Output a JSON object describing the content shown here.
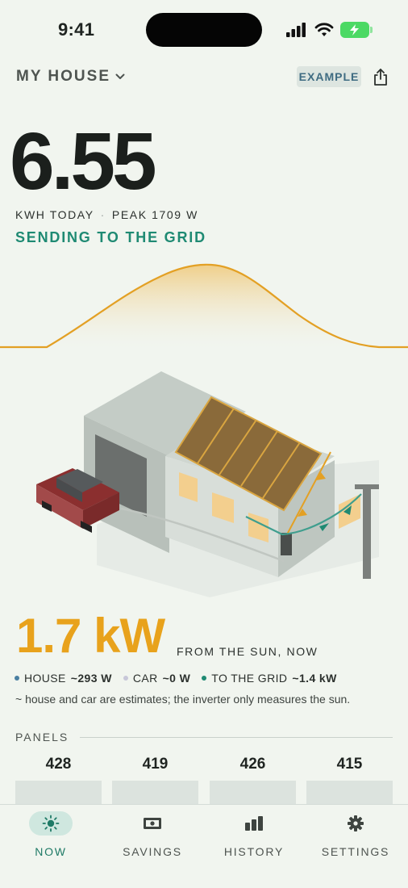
{
  "status_bar": {
    "time": "9:41"
  },
  "header": {
    "house_name": "MY HOUSE",
    "example_badge": "EXAMPLE"
  },
  "today": {
    "energy_value": "6.55",
    "unit_label": "KWH TODAY",
    "separator": "·",
    "peak_label": "PEAK 1709 W",
    "grid_status": "SENDING TO THE GRID"
  },
  "now": {
    "power_value": "1.7 kW",
    "power_suffix": "FROM THE SUN, NOW",
    "legend": [
      {
        "label": "HOUSE",
        "value": "~293 W",
        "color": "#4a7fa1"
      },
      {
        "label": "CAR",
        "value": "~0 W",
        "color": "#c7c7d9"
      },
      {
        "label": "TO THE GRID",
        "value": "~1.4 kW",
        "color": "#1f8a73"
      }
    ],
    "note": "~ house and car are estimates; the inverter only measures the sun."
  },
  "panels": {
    "label": "PANELS",
    "values": [
      "428",
      "419",
      "426",
      "415"
    ]
  },
  "nav": [
    {
      "label": "NOW",
      "icon": "sun-icon",
      "active": true
    },
    {
      "label": "SAVINGS",
      "icon": "money-icon",
      "active": false
    },
    {
      "label": "HISTORY",
      "icon": "bar-chart-icon",
      "active": false
    },
    {
      "label": "SETTINGS",
      "icon": "gear-icon",
      "active": false
    }
  ],
  "colors": {
    "background": "#f1f5ef",
    "solar": "#e8a21c",
    "grid": "#1f8a73",
    "house": "#4a7fa1"
  }
}
